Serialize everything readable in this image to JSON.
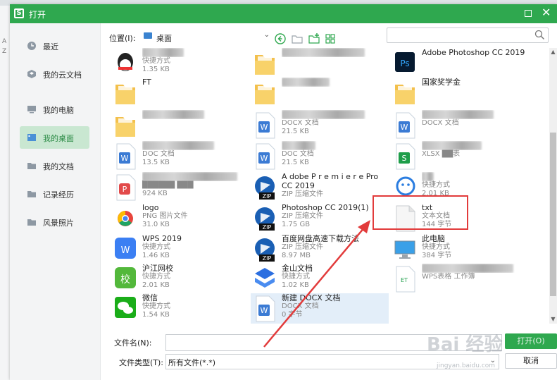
{
  "dialog": {
    "title": "打开",
    "accent": "#2fa84f"
  },
  "sidebar": {
    "items": [
      {
        "label": "最近",
        "icon": "clock-icon"
      },
      {
        "label": "我的云文档",
        "icon": "cloud-docs-icon"
      },
      {
        "label": "我的电脑",
        "icon": "computer-icon"
      },
      {
        "label": "我的桌面",
        "icon": "desktop-icon",
        "active": true
      },
      {
        "label": "我的文档",
        "icon": "folder-icon"
      },
      {
        "label": "记录经历",
        "icon": "folder-icon"
      },
      {
        "label": "风景照片",
        "icon": "folder-icon"
      }
    ]
  },
  "toolbar": {
    "location_label": "位置(I):",
    "location_value": "桌面",
    "search_placeholder": ""
  },
  "files": [
    {
      "name": "███████",
      "type": "快捷方式",
      "size": "1.35 KB",
      "icon": "qq-icon",
      "blur_name": true
    },
    {
      "name": "FT",
      "type": "",
      "size": "",
      "icon": "folder-icon"
    },
    {
      "name": "██████ ████",
      "type": "",
      "size": "",
      "icon": "folder-icon",
      "blur_name": true
    },
    {
      "name": "████████████",
      "type": "DOC 文档",
      "size": "13.5 KB",
      "icon": "word-icon",
      "blur_name": true
    },
    {
      "name": "████████████████",
      "type": "██████ ███",
      "size": "924 KB",
      "icon": "wps-pdf-icon",
      "blur_name": true,
      "blur_type": true
    },
    {
      "name": "logo",
      "type": "PNG 图片文件",
      "size": "31.0 KB",
      "icon": "chrome-icon"
    },
    {
      "name": "WPS 2019",
      "type": "快捷方式",
      "size": "1.46 KB",
      "icon": "wps-icon"
    },
    {
      "name": "沪江网校",
      "type": "快捷方式",
      "size": "2.01 KB",
      "icon": "hujiang-icon"
    },
    {
      "name": "微信",
      "type": "快捷方式",
      "size": "1.54 KB",
      "icon": "wechat-icon"
    },
    {
      "name": "██████████████",
      "type": "",
      "size": "",
      "icon": "folder-icon",
      "blur_name": true
    },
    {
      "name": "████████",
      "type": "",
      "size": "",
      "icon": "folder-icon",
      "blur_name": true
    },
    {
      "name": "██████████████",
      "type": "DOCX 文档",
      "size": "21.5 KB",
      "icon": "word-icon",
      "blur_name": true
    },
    {
      "name": "1████8",
      "type": "DOC 文档",
      "size": "21.5 KB",
      "icon": "word-icon",
      "blur_name": true
    },
    {
      "name": "A dobe P r e m i e r e Pro CC 2019",
      "type": "ZIP 压缩文件",
      "size": "",
      "icon": "zip-icon",
      "wrap": true
    },
    {
      "name": "Photoshop CC 2019(1)",
      "type": "ZIP 压缩文件",
      "size": "1.75 GB",
      "icon": "zip-icon"
    },
    {
      "name": "百度网盘高速下载方法",
      "type": "ZIP 压缩文件",
      "size": "8.97 MB",
      "icon": "zip-icon"
    },
    {
      "name": "金山文档",
      "type": "快捷方式",
      "size": "1.02 KB",
      "icon": "kdocs-icon"
    },
    {
      "name": "新建 DOCX 文档",
      "type": "DOCX 文档",
      "size": "0 字节",
      "icon": "word-icon",
      "selected": true
    },
    {
      "name": "Adobe Photoshop CC 2019",
      "type": "",
      "size": "",
      "icon": "ps-icon"
    },
    {
      "name": "国家奖学金",
      "type": "",
      "size": "",
      "icon": "folder-icon"
    },
    {
      "name": "████████████",
      "type": "DOCX 文档",
      "size": "",
      "icon": "word-icon",
      "blur_name": true
    },
    {
      "name": "██████████",
      "type": "XLSX ██表",
      "size": "",
      "icon": "xlsx-icon",
      "blur_name": true
    },
    {
      "name": "██",
      "type": "快捷方式",
      "size": "2.01 KB",
      "icon": "blue-shortcut-icon",
      "blur_name": true
    },
    {
      "name": "txt",
      "type": "文本文档",
      "size": "144 字节",
      "icon": "txt-icon"
    },
    {
      "name": "此电脑",
      "type": "快捷方式",
      "size": "384 字节",
      "icon": "pc-icon"
    },
    {
      "name": "███████████3 易(2)",
      "type": "WPS表格 工作簿",
      "size": "",
      "icon": "et-icon",
      "blur_name": true
    }
  ],
  "bottom": {
    "filename_label": "文件名(N):",
    "filename_value": "",
    "filetype_label": "文件类型(T):",
    "filetype_value": "所有文件(*.*)",
    "open_button": "打开(O)",
    "cancel_button": "取消"
  },
  "watermark": {
    "text": "Bai 经验",
    "url": "jingyan.baidu.com"
  }
}
